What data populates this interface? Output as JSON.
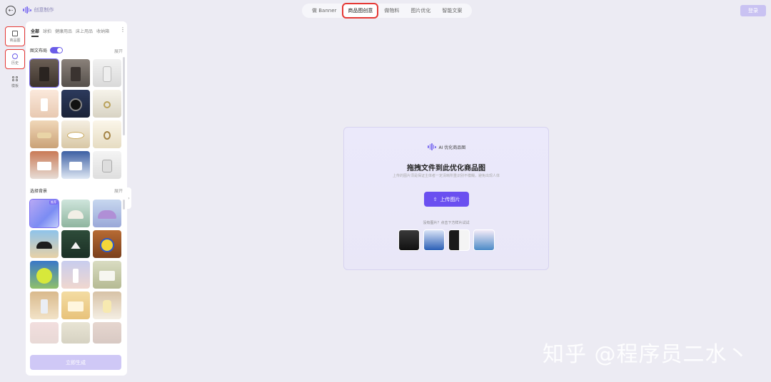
{
  "topbar": {
    "home_icon": "exit-icon",
    "brand_name": "创意制作",
    "tabs": [
      "做 Banner",
      "商品图创意",
      "做物料",
      "图片优化",
      "智能文案"
    ],
    "active_tab": "商品图创意",
    "login_label": "登录"
  },
  "rail": {
    "items": [
      {
        "icon": "product-image-icon",
        "label": "商品图"
      },
      {
        "icon": "history-icon",
        "label": "历史"
      },
      {
        "icon": "template-grid-icon",
        "label": "模板"
      }
    ]
  },
  "panel": {
    "categories": [
      "全部",
      "球拍",
      "健康用品",
      "床上用品",
      "收纳箱"
    ],
    "active_category": "全部",
    "section1": {
      "title": "图文布局",
      "expand": "展开",
      "toggle_on": true
    },
    "section2": {
      "title": "选择背景",
      "expand": "展开",
      "selected_tag": "推荐"
    },
    "generate_label": "立即生成"
  },
  "card": {
    "brand": "AI 优化商品图",
    "title": "拖拽文件到此优化商品图",
    "subtitle": "上传的图片须是保证主体者一定清晰所重识别不模糊，避免出现人体",
    "upload_label": "上传图片",
    "try_text": "没有图片？点击下方样片试试"
  },
  "watermark": "知乎 @程序员二水丶",
  "colors": {
    "accent": "#6a4ff0",
    "highlight_box": "#e53935",
    "background": "#ecebf3"
  }
}
